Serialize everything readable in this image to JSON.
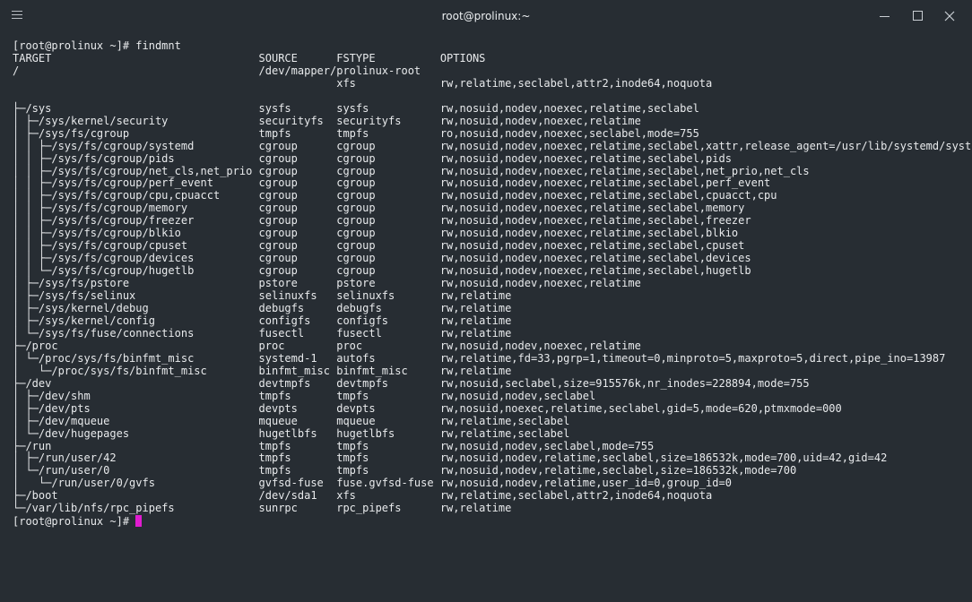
{
  "window": {
    "title": "root@prolinux:~"
  },
  "terminal": {
    "lines": [
      "[root@prolinux ~]# findmnt",
      "TARGET                                SOURCE      FSTYPE          OPTIONS",
      "/                                     /dev/mapper/prolinux-root",
      "                                                  xfs             rw,relatime,seclabel,attr2,inode64,noquota",
      "",
      "├─/sys                                sysfs       sysfs           rw,nosuid,nodev,noexec,relatime,seclabel",
      "│ ├─/sys/kernel/security              securityfs  securityfs      rw,nosuid,nodev,noexec,relatime",
      "│ ├─/sys/fs/cgroup                    tmpfs       tmpfs           ro,nosuid,nodev,noexec,seclabel,mode=755",
      "│ │ ├─/sys/fs/cgroup/systemd          cgroup      cgroup          rw,nosuid,nodev,noexec,relatime,seclabel,xattr,release_agent=/usr/lib/systemd/system",
      "│ │ ├─/sys/fs/cgroup/pids             cgroup      cgroup          rw,nosuid,nodev,noexec,relatime,seclabel,pids",
      "│ │ ├─/sys/fs/cgroup/net_cls,net_prio cgroup      cgroup          rw,nosuid,nodev,noexec,relatime,seclabel,net_prio,net_cls",
      "│ │ ├─/sys/fs/cgroup/perf_event       cgroup      cgroup          rw,nosuid,nodev,noexec,relatime,seclabel,perf_event",
      "│ │ ├─/sys/fs/cgroup/cpu,cpuacct      cgroup      cgroup          rw,nosuid,nodev,noexec,relatime,seclabel,cpuacct,cpu",
      "│ │ ├─/sys/fs/cgroup/memory           cgroup      cgroup          rw,nosuid,nodev,noexec,relatime,seclabel,memory",
      "│ │ ├─/sys/fs/cgroup/freezer          cgroup      cgroup          rw,nosuid,nodev,noexec,relatime,seclabel,freezer",
      "│ │ ├─/sys/fs/cgroup/blkio            cgroup      cgroup          rw,nosuid,nodev,noexec,relatime,seclabel,blkio",
      "│ │ ├─/sys/fs/cgroup/cpuset           cgroup      cgroup          rw,nosuid,nodev,noexec,relatime,seclabel,cpuset",
      "│ │ ├─/sys/fs/cgroup/devices          cgroup      cgroup          rw,nosuid,nodev,noexec,relatime,seclabel,devices",
      "│ │ └─/sys/fs/cgroup/hugetlb          cgroup      cgroup          rw,nosuid,nodev,noexec,relatime,seclabel,hugetlb",
      "│ ├─/sys/fs/pstore                    pstore      pstore          rw,nosuid,nodev,noexec,relatime",
      "│ ├─/sys/fs/selinux                   selinuxfs   selinuxfs       rw,relatime",
      "│ ├─/sys/kernel/debug                 debugfs     debugfs         rw,relatime",
      "│ ├─/sys/kernel/config                configfs    configfs        rw,relatime",
      "│ └─/sys/fs/fuse/connections          fusectl     fusectl         rw,relatime",
      "├─/proc                               proc        proc            rw,nosuid,nodev,noexec,relatime",
      "│ └─/proc/sys/fs/binfmt_misc          systemd-1   autofs          rw,relatime,fd=33,pgrp=1,timeout=0,minproto=5,maxproto=5,direct,pipe_ino=13987",
      "│   └─/proc/sys/fs/binfmt_misc        binfmt_misc binfmt_misc     rw,relatime",
      "├─/dev                                devtmpfs    devtmpfs        rw,nosuid,seclabel,size=915576k,nr_inodes=228894,mode=755",
      "│ ├─/dev/shm                          tmpfs       tmpfs           rw,nosuid,nodev,seclabel",
      "│ ├─/dev/pts                          devpts      devpts          rw,nosuid,noexec,relatime,seclabel,gid=5,mode=620,ptmxmode=000",
      "│ ├─/dev/mqueue                       mqueue      mqueue          rw,relatime,seclabel",
      "│ └─/dev/hugepages                    hugetlbfs   hugetlbfs       rw,relatime,seclabel",
      "├─/run                                tmpfs       tmpfs           rw,nosuid,nodev,seclabel,mode=755",
      "│ ├─/run/user/42                      tmpfs       tmpfs           rw,nosuid,nodev,relatime,seclabel,size=186532k,mode=700,uid=42,gid=42",
      "│ └─/run/user/0                       tmpfs       tmpfs           rw,nosuid,nodev,relatime,seclabel,size=186532k,mode=700",
      "│   └─/run/user/0/gvfs                gvfsd-fuse  fuse.gvfsd-fuse rw,nosuid,nodev,relatime,user_id=0,group_id=0",
      "├─/boot                               /dev/sda1   xfs             rw,relatime,seclabel,attr2,inode64,noquota",
      "└─/var/lib/nfs/rpc_pipefs             sunrpc      rpc_pipefs      rw,relatime"
    ],
    "prompt": "[root@prolinux ~]# "
  },
  "colors": {
    "background": "#272d33",
    "text": "#e8eaec",
    "cursor": "#e01cd0"
  }
}
